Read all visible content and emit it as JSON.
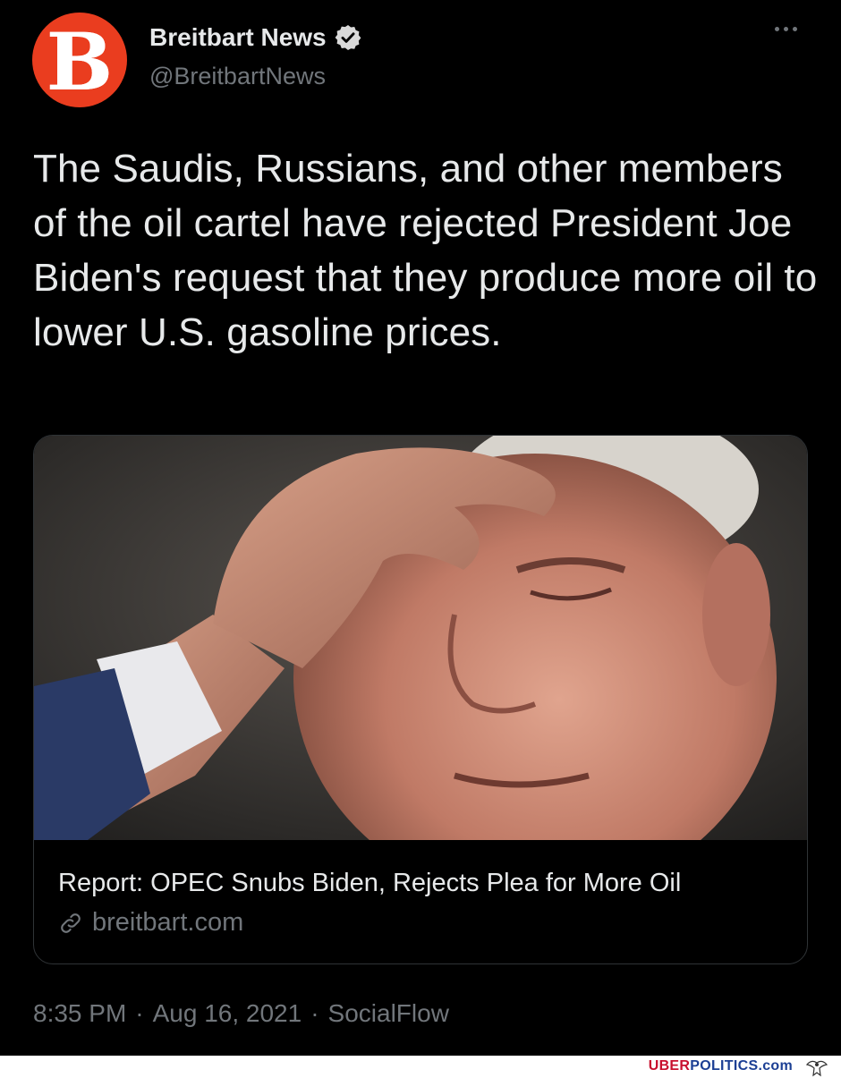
{
  "author": {
    "display_name": "Breitbart News",
    "handle": "@BreitbartNews",
    "avatar_letter": "B",
    "avatar_color": "#ea3d1f",
    "verified": true
  },
  "tweet": {
    "text": "The Saudis, Russians, and other members of the oil cartel have rejected President Joe Biden's request that they produce more oil to lower U.S. gasoline prices."
  },
  "card": {
    "title": "Report: OPEC Snubs Biden, Rejects Plea for More Oil",
    "domain": "breitbart.com",
    "domain_icon": "link-icon"
  },
  "meta": {
    "time": "8:35 PM",
    "separator": "·",
    "date": "Aug 16, 2021",
    "source": "SocialFlow"
  },
  "watermark": {
    "part1": "UBER",
    "part2": "POLITICS.com"
  },
  "colors": {
    "background": "#000000",
    "text": "#e7e9ea",
    "muted": "#71767b",
    "border": "#2f3336",
    "verified_badge": "#d9d9d9"
  }
}
